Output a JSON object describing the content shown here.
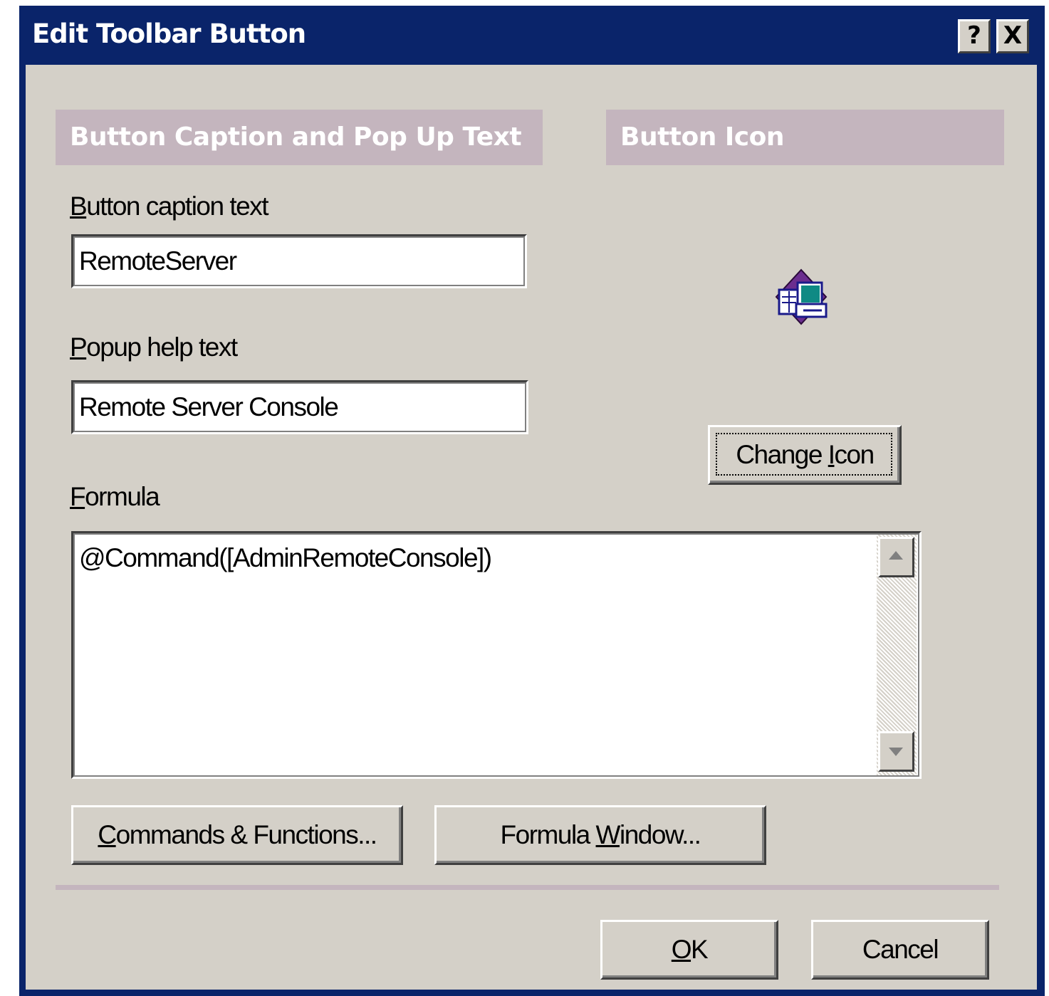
{
  "window": {
    "title": "Edit Toolbar Button",
    "help_glyph": "?",
    "close_glyph": "X"
  },
  "sections": {
    "caption_header": "Button Caption and Pop Up Text",
    "icon_header": "Button Icon"
  },
  "caption": {
    "label_first": "B",
    "label_rest": "utton caption text",
    "value": "RemoteServer"
  },
  "popup": {
    "label_first": "P",
    "label_rest": "opup help text",
    "value": "Remote Server Console"
  },
  "formula": {
    "label_first": "F",
    "label_rest": "ormula",
    "value": "@Command([AdminRemoteConsole])"
  },
  "buttons": {
    "change_icon_pre": "Change ",
    "change_icon_u": "I",
    "change_icon_post": "con",
    "commands_u": "C",
    "commands_rest": "ommands & Functions...",
    "formula_window_pre": "Formula ",
    "formula_window_u": "W",
    "formula_window_post": "indow...",
    "ok_u": "O",
    "ok_rest": "K",
    "cancel": "Cancel"
  },
  "icons": {
    "button_icon": "remote-server-console-icon",
    "help": "help-icon",
    "close": "close-icon",
    "scroll_up": "scroll-up-arrow-icon",
    "scroll_down": "scroll-down-arrow-icon"
  },
  "colors": {
    "title_bar": "#0a246a",
    "dialog_face": "#d4d0c8",
    "section_header": "#c4b5be"
  }
}
